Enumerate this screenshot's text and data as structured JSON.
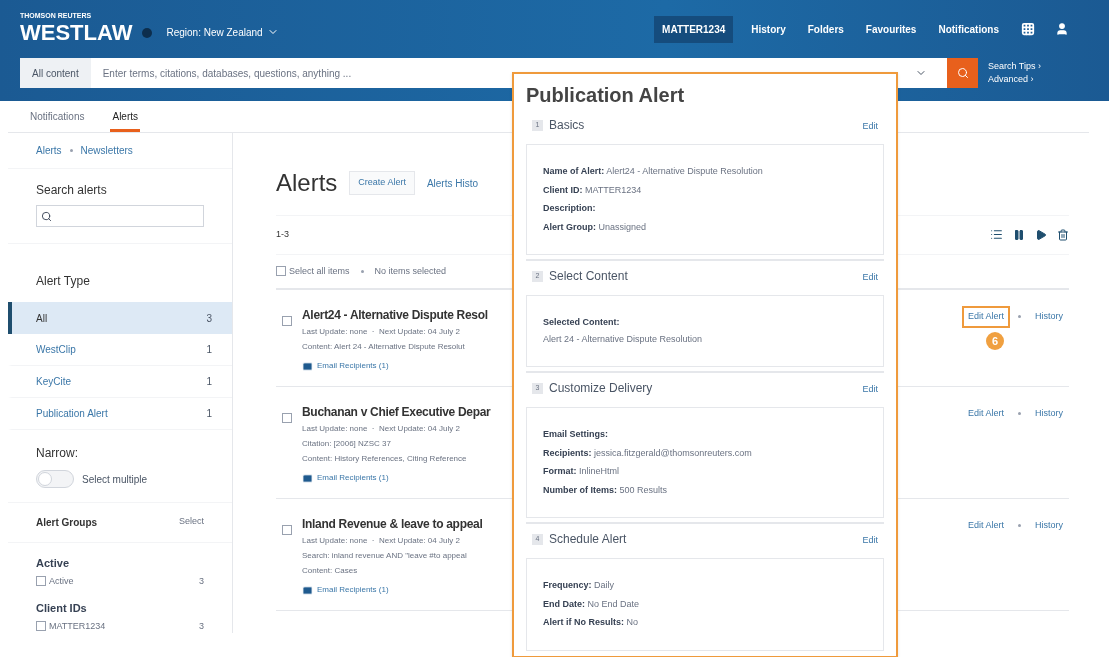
{
  "header": {
    "brand_small": "THOMSON REUTERS",
    "brand": "WESTLAW",
    "region": "Region: New Zealand",
    "nav": [
      {
        "label": "MATTER1234",
        "kind": "client"
      },
      {
        "label": "History",
        "kind": "link"
      },
      {
        "label": "Folders",
        "kind": "link"
      },
      {
        "label": "Favourites",
        "kind": "link"
      },
      {
        "label": "Notifications",
        "kind": "link"
      }
    ]
  },
  "search": {
    "scope": "All content",
    "placeholder": "Enter terms, citations, databases, questions, anything ...",
    "links": [
      "Search Tips ›",
      "Advanced ›"
    ]
  },
  "tabs": [
    {
      "label": "Notifications",
      "selected": false
    },
    {
      "label": "Alerts",
      "selected": true
    }
  ],
  "sidebar": {
    "breadcrumbs": [
      "Alerts",
      "Newsletters"
    ],
    "search_label": "Search alerts",
    "alert_type_title": "Alert Type",
    "alert_types": [
      {
        "label": "All",
        "count": "3",
        "selected": true
      },
      {
        "label": "WestClip",
        "count": "1",
        "selected": false
      },
      {
        "label": "KeyCite",
        "count": "1",
        "selected": false
      },
      {
        "label": "Publication Alert",
        "count": "1",
        "selected": false
      }
    ],
    "narrow_label": "Narrow:",
    "toggle": {
      "label": "Select multiple",
      "on": false
    },
    "groups_title": "Alert Groups",
    "groups_action": "Select",
    "filters": [
      {
        "heading": "Active",
        "items": [
          {
            "label": "Active",
            "count": "3",
            "checked": false
          }
        ]
      },
      {
        "heading": "Client IDs",
        "items": [
          {
            "label": "MATTER1234",
            "count": "3",
            "checked": false
          }
        ]
      }
    ]
  },
  "main": {
    "title": "Alerts",
    "create_button": "Create Alert",
    "history_tab": "Alerts Histo",
    "range": "1-3",
    "select_all": {
      "label": "Select all items",
      "checked": false
    },
    "selection_status": "No items selected",
    "alerts": [
      {
        "title": "Alert24 - Alternative Dispute Resol",
        "checked": false,
        "lines": [
          "Last Update: none  ·  Next Update: 04 July 2",
          "Content: Alert 24 - Alternative Dispute Resolut"
        ],
        "email": "Email Recipients (1)",
        "actions": [
          {
            "label": "Edit Alert",
            "highlighted": true
          },
          {
            "label": "History",
            "highlighted": false
          }
        ]
      },
      {
        "title": "Buchanan v Chief Executive Depar",
        "checked": false,
        "lines": [
          "Last Update: none  ·  Next Update: 04 July 2",
          "Citation: [2006] NZSC 37",
          "Content: History References, Citing Reference"
        ],
        "email": "Email Recipients (1)",
        "actions": [
          {
            "label": "Edit Alert",
            "highlighted": false
          },
          {
            "label": "History",
            "highlighted": false
          }
        ]
      },
      {
        "title": "Inland Revenue & leave to appeal",
        "checked": false,
        "lines": [
          "Last Update: none  ·  Next Update: 04 July 2",
          "Search: inland revenue AND \"leave #to appeal",
          "Content: Cases"
        ],
        "email": "Email Recipients (1)",
        "actions": [
          {
            "label": "Edit Alert",
            "highlighted": false
          },
          {
            "label": "History",
            "highlighted": false
          }
        ]
      }
    ],
    "callout": "6"
  },
  "popup": {
    "title": "Publication Alert",
    "sections": [
      {
        "number": "1",
        "title": "Basics",
        "edit": "Edit",
        "fields": [
          {
            "label": "Name of Alert:",
            "value": "Alert24 - Alternative Dispute Resolution",
            "kind": "inline"
          },
          {
            "label": "Client ID:",
            "value": "MATTER1234",
            "kind": "inline"
          },
          {
            "label": "Description:",
            "kind": "inline"
          },
          {
            "label": "Alert Group:",
            "value": "Unassigned",
            "kind": "inline"
          }
        ]
      },
      {
        "number": "2",
        "title": "Select Content",
        "edit": "Edit",
        "fields": [
          {
            "label": "Selected Content:",
            "value": "Alert 24 - Alternative Dispute Resolution",
            "kind": "block"
          }
        ]
      },
      {
        "number": "3",
        "title": "Customize Delivery",
        "edit": "Edit",
        "fields": [
          {
            "label": "Email Settings:",
            "kind": "inline"
          },
          {
            "label": "Recipients:",
            "value": "jessica.fitzgerald@thomsonreuters.com",
            "kind": "inline"
          },
          {
            "label": "Format:",
            "value": "InlineHtml",
            "kind": "inline"
          },
          {
            "label": "Number of Items:",
            "value": "500 Results",
            "kind": "inline"
          }
        ]
      },
      {
        "number": "4",
        "title": "Schedule Alert",
        "edit": "Edit",
        "fields": [
          {
            "label": "Frequency:",
            "value": "Daily",
            "kind": "inline"
          },
          {
            "label": "End Date:",
            "value": "No End Date",
            "kind": "inline"
          },
          {
            "label": "Alert if No Results:",
            "value": "No",
            "kind": "inline"
          }
        ]
      }
    ]
  }
}
